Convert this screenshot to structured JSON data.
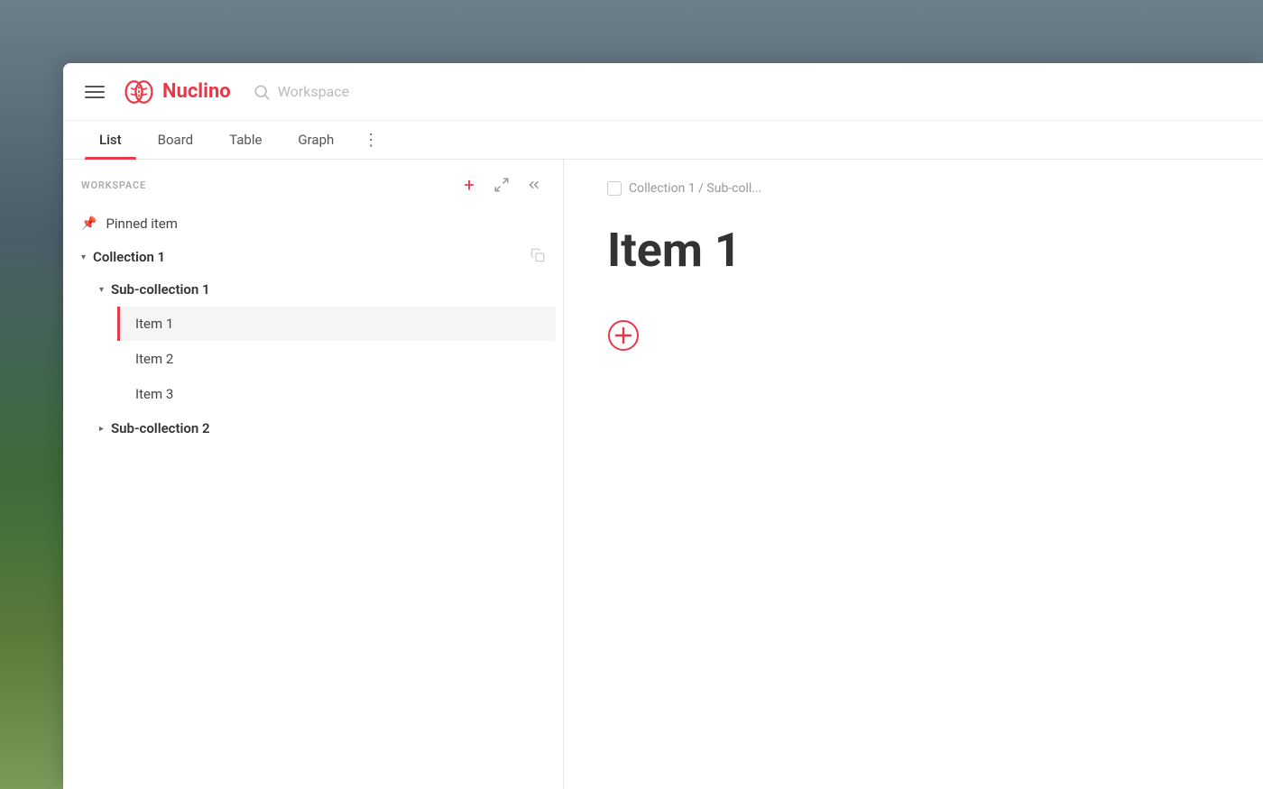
{
  "app": {
    "name": "Nuclino"
  },
  "header": {
    "search_placeholder": "Workspace"
  },
  "tabs": [
    {
      "id": "list",
      "label": "List",
      "active": true
    },
    {
      "id": "board",
      "label": "Board",
      "active": false
    },
    {
      "id": "table",
      "label": "Table",
      "active": false
    },
    {
      "id": "graph",
      "label": "Graph",
      "active": false
    }
  ],
  "sidebar": {
    "workspace_label": "WORKSPACE",
    "pinned_item_label": "Pinned item",
    "collections": [
      {
        "id": "collection1",
        "name": "Collection 1",
        "expanded": true,
        "sub_collections": [
          {
            "id": "sub1",
            "name": "Sub-collection 1",
            "expanded": true,
            "items": [
              {
                "id": "item1",
                "name": "Item 1",
                "selected": true
              },
              {
                "id": "item2",
                "name": "Item 2",
                "selected": false
              },
              {
                "id": "item3",
                "name": "Item 3",
                "selected": false
              }
            ]
          },
          {
            "id": "sub2",
            "name": "Sub-collection 2",
            "expanded": false,
            "items": []
          }
        ]
      }
    ]
  },
  "document": {
    "breadcrumb": "Collection 1 / Sub-coll...",
    "title": "Item 1"
  },
  "icons": {
    "hamburger": "☰",
    "search": "🔍",
    "add": "+",
    "expand": "⤢",
    "collapse": "«",
    "pin": "📌",
    "chevron_down": "▾",
    "chevron_right": "▸",
    "copy": "⧉",
    "add_circle": "⊕",
    "more": "⋮"
  }
}
